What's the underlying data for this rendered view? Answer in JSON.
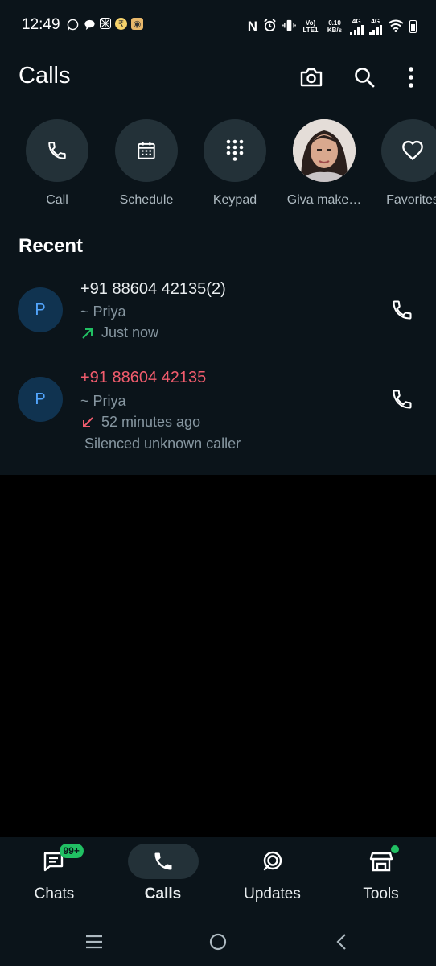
{
  "status": {
    "time": "12:49",
    "volte": "Vo) LTE1",
    "speed": "0.10 KB/s",
    "net1": "4G",
    "net2": "4G"
  },
  "header": {
    "title": "Calls"
  },
  "quick_actions": [
    {
      "label": "Call",
      "icon": "phone-icon"
    },
    {
      "label": "Schedule",
      "icon": "calendar-icon"
    },
    {
      "label": "Keypad",
      "icon": "keypad-icon"
    },
    {
      "label": "Giva make…",
      "icon": "contact-photo"
    },
    {
      "label": "Favorites",
      "icon": "heart-icon"
    }
  ],
  "recent": {
    "title": "Recent",
    "items": [
      {
        "initial": "P",
        "number": "+91 88604 42135",
        "count": "(2)",
        "name": "~ Priya",
        "direction": "outgoing",
        "time": "Just now",
        "note": "",
        "number_color": "#e9edef",
        "arrow_color": "#21c063"
      },
      {
        "initial": "P",
        "number": "+91 88604 42135",
        "count": "",
        "name": "~ Priya",
        "direction": "missed",
        "time": "52 minutes ago",
        "note": "Silenced unknown caller",
        "number_color": "#f15c6d",
        "arrow_color": "#f15c6d"
      }
    ]
  },
  "bottom_nav": [
    {
      "label": "Chats",
      "badge": "99+",
      "active": false
    },
    {
      "label": "Calls",
      "badge": "",
      "active": true
    },
    {
      "label": "Updates",
      "badge": "",
      "active": false
    },
    {
      "label": "Tools",
      "badge": "",
      "active": false
    }
  ],
  "colors": {
    "background": "#0b141a",
    "accent_green": "#21c063",
    "missed_red": "#f15c6d",
    "chip": "#233138"
  }
}
